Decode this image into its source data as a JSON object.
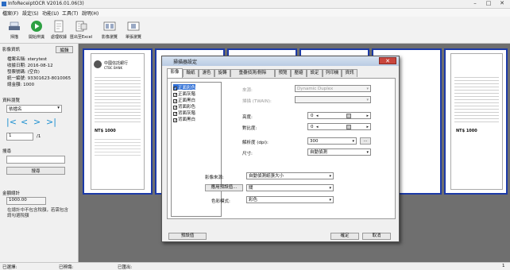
{
  "titlebar": {
    "title": "InfoReceiptOCR V2016.01.06(3)",
    "minimize": "–",
    "maximize": "□",
    "close": "✕"
  },
  "menu": [
    "檔案(F)",
    "設定(S)",
    "功能(U)",
    "工具(T)",
    "說明(H)"
  ],
  "toolbar": [
    {
      "label": "掃描",
      "icon": "scanner-icon"
    },
    {
      "label": "開始辨識",
      "icon": "play-icon"
    },
    {
      "label": "處理收據",
      "icon": "receipt-process-icon"
    },
    {
      "label": "匯出至Excel",
      "icon": "excel-export-icon"
    },
    {
      "label": "影像瀏覽",
      "icon": "image-view-icon"
    },
    {
      "label": "單張瀏覽",
      "icon": "single-view-icon"
    }
  ],
  "left_panel": {
    "info_title": "影像資訊",
    "edit_button": "編輯",
    "file_name": "檔案名稱: sterytest",
    "doc_date": "收據日期: 2016-08-12",
    "doc_no": "發票號碼: (空白)",
    "id_no": "統一編號: 93301623-8010065",
    "amount": "總金額: 1000",
    "browse_title": "資料瀏覽",
    "browse_select": "依檔名",
    "page_value": "1",
    "page_total": "/1",
    "search_title": "搜尋",
    "search_value": "",
    "search_button": "搜尋",
    "total_title": "金額總計",
    "total_value": "1000.00",
    "note": "在總計中不包含稅額，若需包含請勾選稅額"
  },
  "nav": {
    "first": "|<",
    "prev": "<",
    "next": ">",
    "last": ">|"
  },
  "receipt": {
    "bank": "中國信託銀行",
    "bank_en": "CTBC BANK",
    "total": "NT$ 1000"
  },
  "dialog": {
    "title": "掃描器設定",
    "close": "✕",
    "tabs": [
      "影像",
      "輸紙",
      "濾色",
      "旋轉",
      "重疊偵測/刪除",
      "預覽",
      "壓縮",
      "設定",
      "列印機",
      "資訊"
    ],
    "list_items": [
      "正面彩色",
      "正面灰階",
      "正面黑白",
      "背面彩色",
      "背面灰階",
      "背面黑白"
    ],
    "fields": {
      "scanner_label": "來源:",
      "scanner_value": "Dynamic Duplex",
      "scan_mode_label": "掃描 (TWAIN):",
      "brightness_label": "亮度:",
      "brightness_value": "0",
      "contrast_label": "對比度:",
      "contrast_value": "0",
      "resolution_label": "解析度 (dpi):",
      "resolution_value": "300",
      "more_button": "...",
      "paper_label": "尺寸:",
      "paper_value": "自動偵測"
    },
    "lower": {
      "setting1_label": "影像來源:",
      "setting1_value": "自動偵測紙張大小",
      "setting2_label": "應用預設值...",
      "setting2_value": "關",
      "setting3_label": "色彩模式:",
      "setting3_value": "彩色"
    },
    "buttons": {
      "default": "預設值",
      "ok": "確定",
      "cancel": "取消"
    }
  },
  "status": {
    "s1": "已選擇:",
    "s2": "已辨識:",
    "s3": "已匯出:",
    "s4": "1"
  }
}
